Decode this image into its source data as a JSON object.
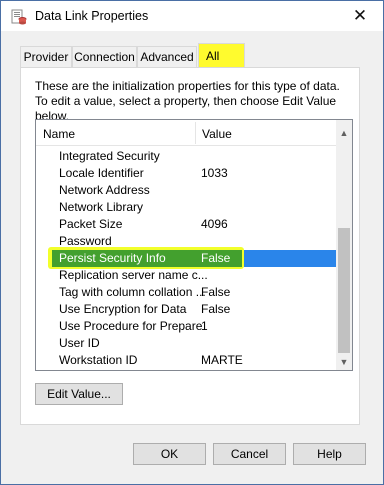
{
  "window": {
    "title": "Data Link Properties",
    "icon": "data-link-icon",
    "close_icon": "close-icon"
  },
  "tabs": [
    {
      "label": "Provider",
      "active": false
    },
    {
      "label": "Connection",
      "active": false
    },
    {
      "label": "Advanced",
      "active": false
    },
    {
      "label": "All",
      "active": true
    }
  ],
  "intro_text": "These are the initialization properties for this type of data. To edit a value, select a property, then choose Edit Value below.",
  "list": {
    "headers": {
      "name": "Name",
      "value": "Value"
    },
    "rows": [
      {
        "name": "Integrated Security",
        "value": ""
      },
      {
        "name": "Locale Identifier",
        "value": "1033"
      },
      {
        "name": "Network Address",
        "value": ""
      },
      {
        "name": "Network Library",
        "value": ""
      },
      {
        "name": "Packet Size",
        "value": "4096"
      },
      {
        "name": "Password",
        "value": ""
      },
      {
        "name": "Persist Security Info",
        "value": "False",
        "selected": true
      },
      {
        "name": "Replication server name c...",
        "value": ""
      },
      {
        "name": "Tag with column collation ...",
        "value": "False"
      },
      {
        "name": "Use Encryption for Data",
        "value": "False"
      },
      {
        "name": "Use Procedure for Prepare",
        "value": "1"
      },
      {
        "name": "User ID",
        "value": ""
      },
      {
        "name": "Workstation ID",
        "value": "MARTE"
      }
    ]
  },
  "buttons": {
    "edit_value": "Edit Value...",
    "ok": "OK",
    "cancel": "Cancel",
    "help": "Help"
  },
  "colors": {
    "highlight_yellow": "#f2ff2b",
    "selection_green": "#43a02e",
    "selection_blue": "#2a85ea"
  }
}
